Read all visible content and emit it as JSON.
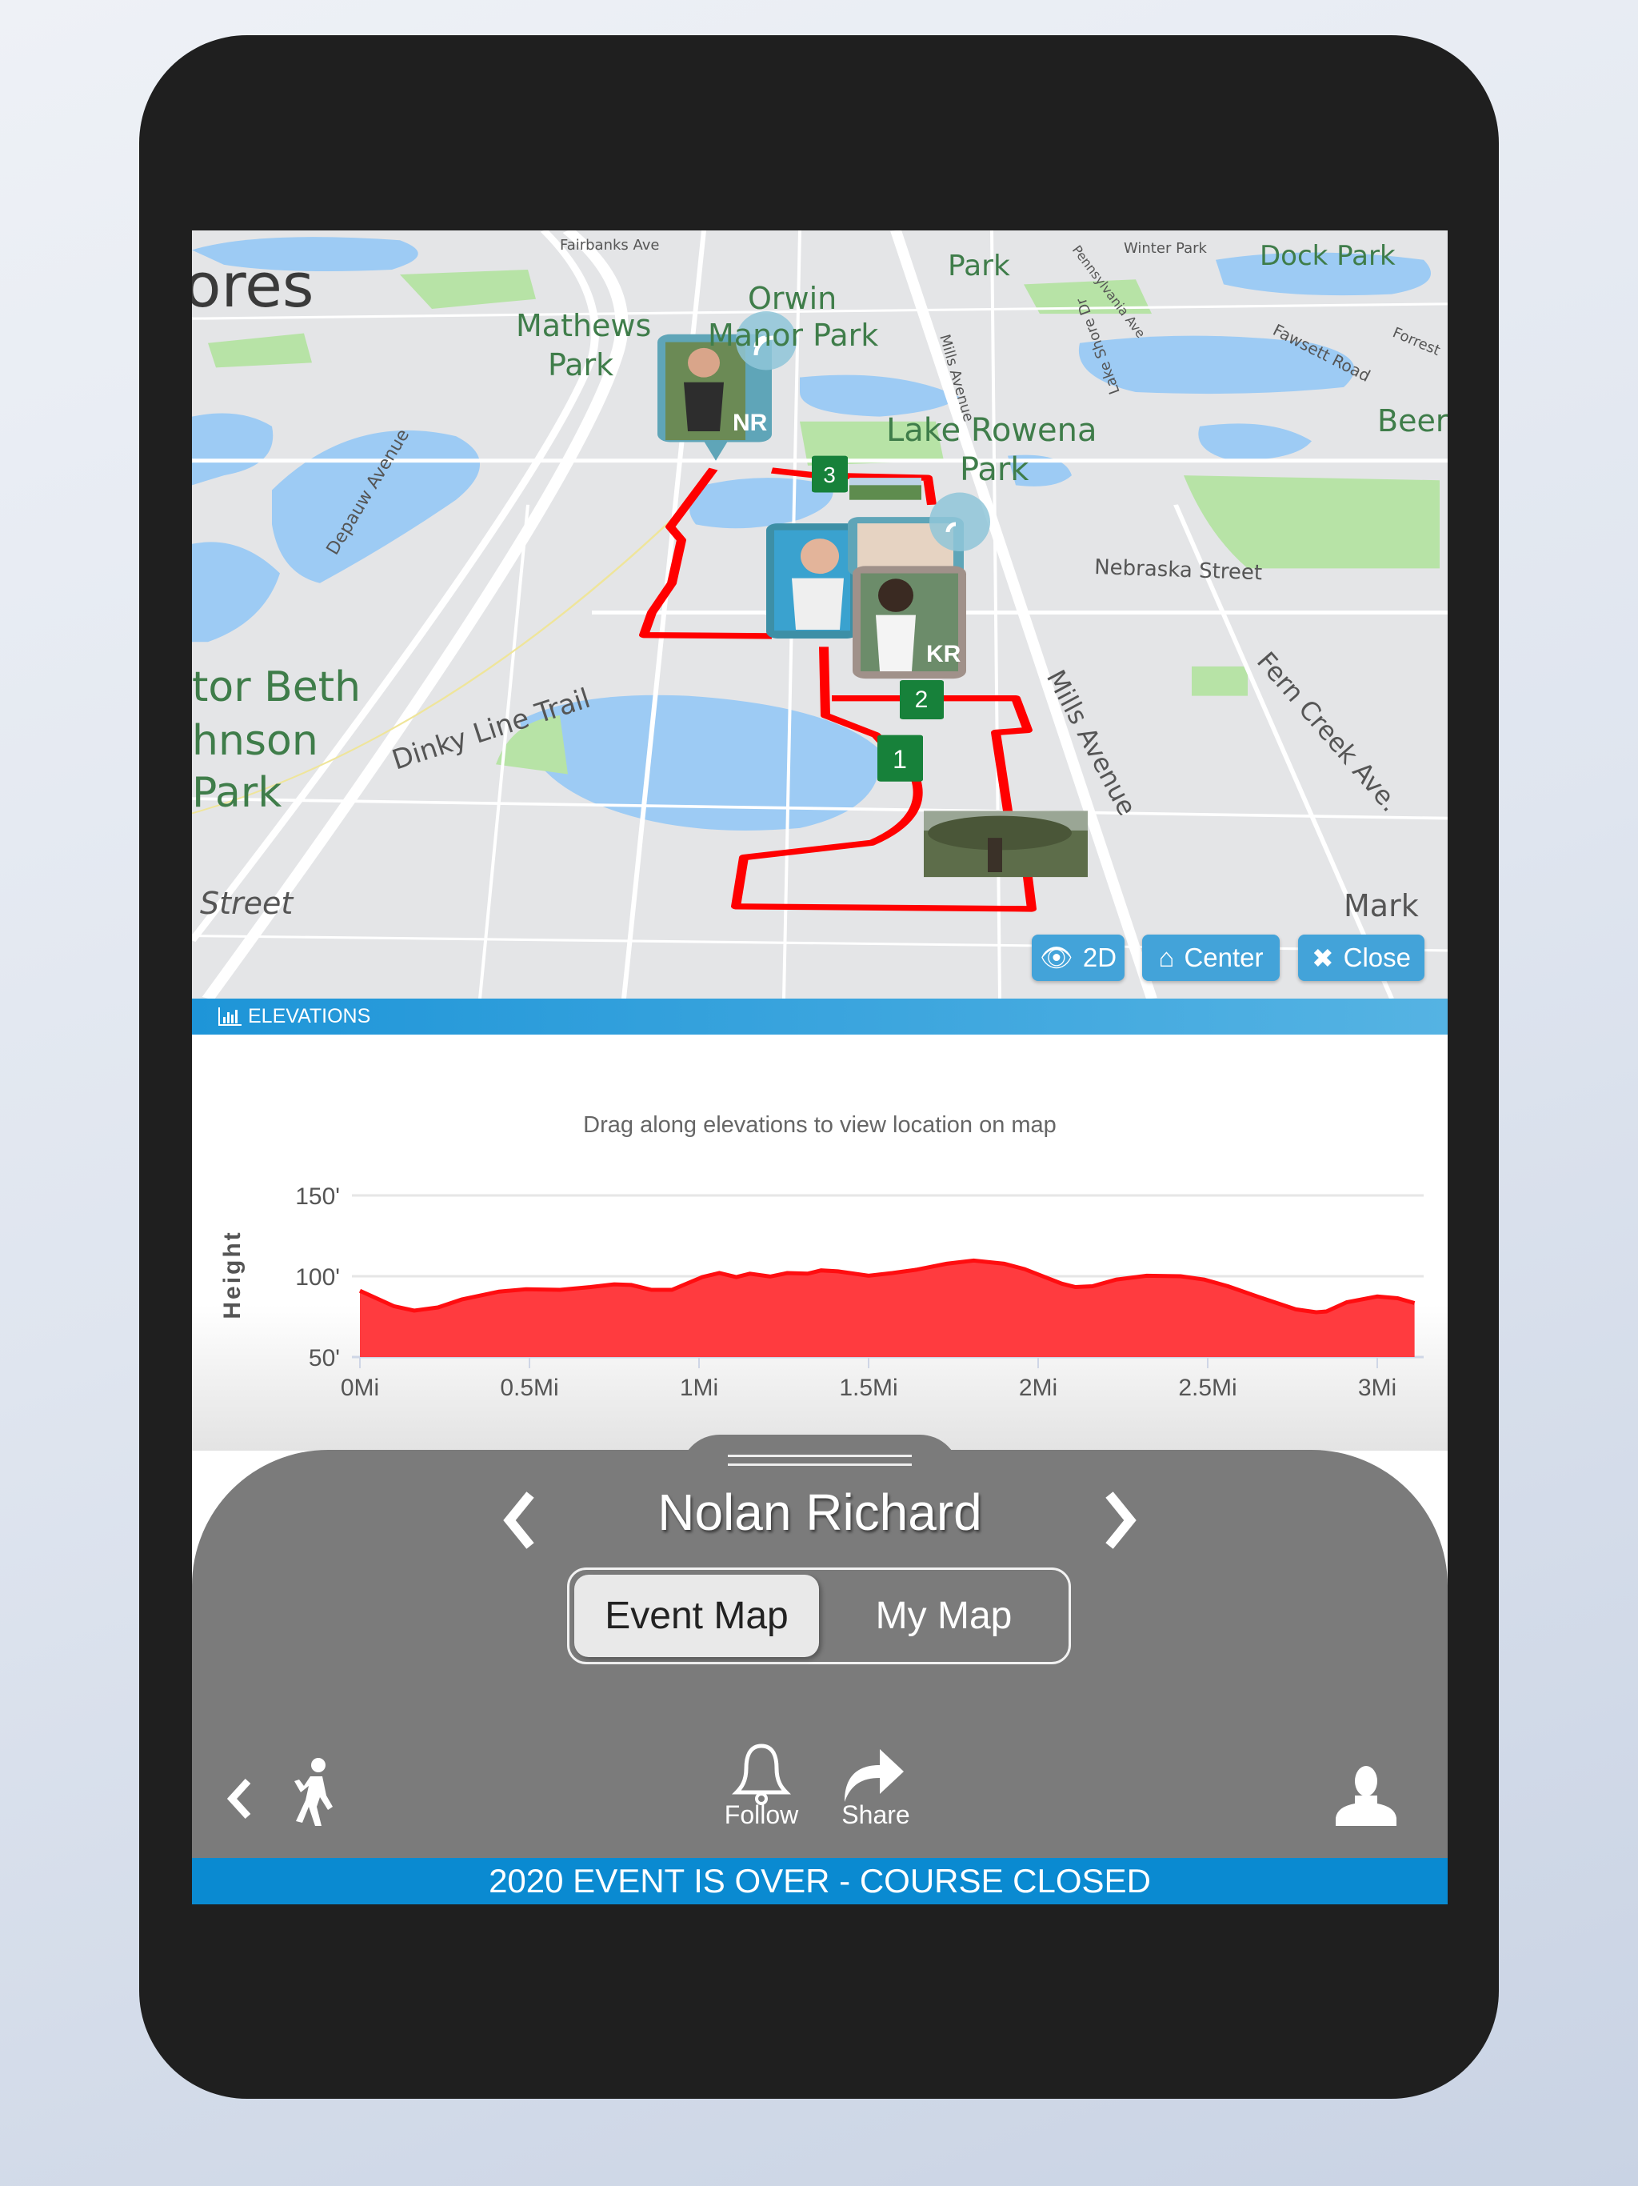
{
  "map": {
    "labels": {
      "city_partial": "ores",
      "mathews": "Mathews",
      "mathews_park": "Park",
      "orwin": "Orwin",
      "manor_park": "Manor Park",
      "lake_rowena": "Lake Rowena",
      "lake_rowena_park": "Park",
      "dock_park": "Dock Park",
      "winter_park": "Winter Park",
      "top_park": "Park",
      "beer": "Beer",
      "mark": "Mark",
      "tor_beth": "tor Beth",
      "hnson": "hnson",
      "beth_park": "Park",
      "street": "Street",
      "fairbanks": "Fairbanks Ave",
      "pennsylvania": "Pennsylvania Ave",
      "fawsett": "Fawsett Road",
      "forrest": "Forrest",
      "lake_shore": "Lake Shore Dr",
      "mills_top": "Mills Avenue",
      "mills": "Mills Avenue",
      "nebraska": "Nebraska Street",
      "fern_creek": "Fern Creek Ave.",
      "depauw": "Depauw Avenue",
      "dinky": "Dinky Line Trail"
    },
    "checkpoints": [
      "1",
      "2",
      "3"
    ],
    "runner_markers": [
      {
        "initials": "NR",
        "live": true
      },
      {
        "initials": "",
        "live": false
      },
      {
        "initials": "",
        "live": true
      },
      {
        "initials": "KR",
        "live": false
      }
    ],
    "route_color": "#ff0000",
    "buttons": {
      "view_2d": {
        "label": "2D",
        "icon": "eye-icon"
      },
      "center": {
        "label": "Center",
        "icon": "home-icon"
      },
      "close": {
        "label": "Close",
        "icon": "close-icon"
      }
    }
  },
  "elevations": {
    "header": "ELEVATIONS",
    "header_icon": "bar-chart-icon",
    "instruction": "Drag along elevations to view location on map"
  },
  "chart_data": {
    "type": "area",
    "ylabel": "Height",
    "xlabel": "",
    "xlim": [
      0,
      3.11
    ],
    "ylim": [
      50,
      150
    ],
    "y_ticks": [
      "50'",
      "100'",
      "150'"
    ],
    "y_tick_values": [
      50,
      100,
      150
    ],
    "x_ticks": [
      "0Mi",
      "0.5Mi",
      "1Mi",
      "1.5Mi",
      "2Mi",
      "2.5Mi",
      "3Mi"
    ],
    "x_tick_values": [
      0,
      0.5,
      1,
      1.5,
      2,
      2.5,
      3
    ],
    "grid": true,
    "color": "#ff3b3f",
    "x": [
      0,
      0.1,
      0.16,
      0.23,
      0.3,
      0.41,
      0.49,
      0.59,
      0.68,
      0.75,
      0.8,
      0.86,
      0.92,
      1.01,
      1.06,
      1.11,
      1.15,
      1.21,
      1.26,
      1.32,
      1.36,
      1.41,
      1.5,
      1.57,
      1.64,
      1.73,
      1.81,
      1.9,
      1.96,
      2.07,
      2.11,
      2.16,
      2.23,
      2.32,
      2.42,
      2.49,
      2.56,
      2.65,
      2.76,
      2.82,
      2.85,
      2.91,
      3.0,
      3.06,
      3.11
    ],
    "y": [
      91,
      81.5,
      78.7,
      80.7,
      85.6,
      90.5,
      92,
      91.6,
      93.3,
      95,
      94.6,
      91.6,
      91.6,
      99.5,
      102,
      99.5,
      101.6,
      99.8,
      102,
      101.6,
      103.6,
      103,
      100.3,
      102,
      104,
      107.7,
      109.7,
      107.7,
      104.4,
      95.4,
      93.3,
      93.8,
      97.9,
      100.3,
      100,
      97.9,
      93.8,
      87.2,
      79.5,
      77.7,
      78.2,
      83.9,
      87.5,
      86.4,
      83.4
    ]
  },
  "athlete": {
    "name": "Nolan Richard"
  },
  "map_toggle": {
    "options": [
      "Event Map",
      "My Map"
    ],
    "selected": "Event Map"
  },
  "toolbar": {
    "follow_label": "Follow",
    "share_label": "Share"
  },
  "banner": "2020 EVENT IS OVER - COURSE CLOSED"
}
